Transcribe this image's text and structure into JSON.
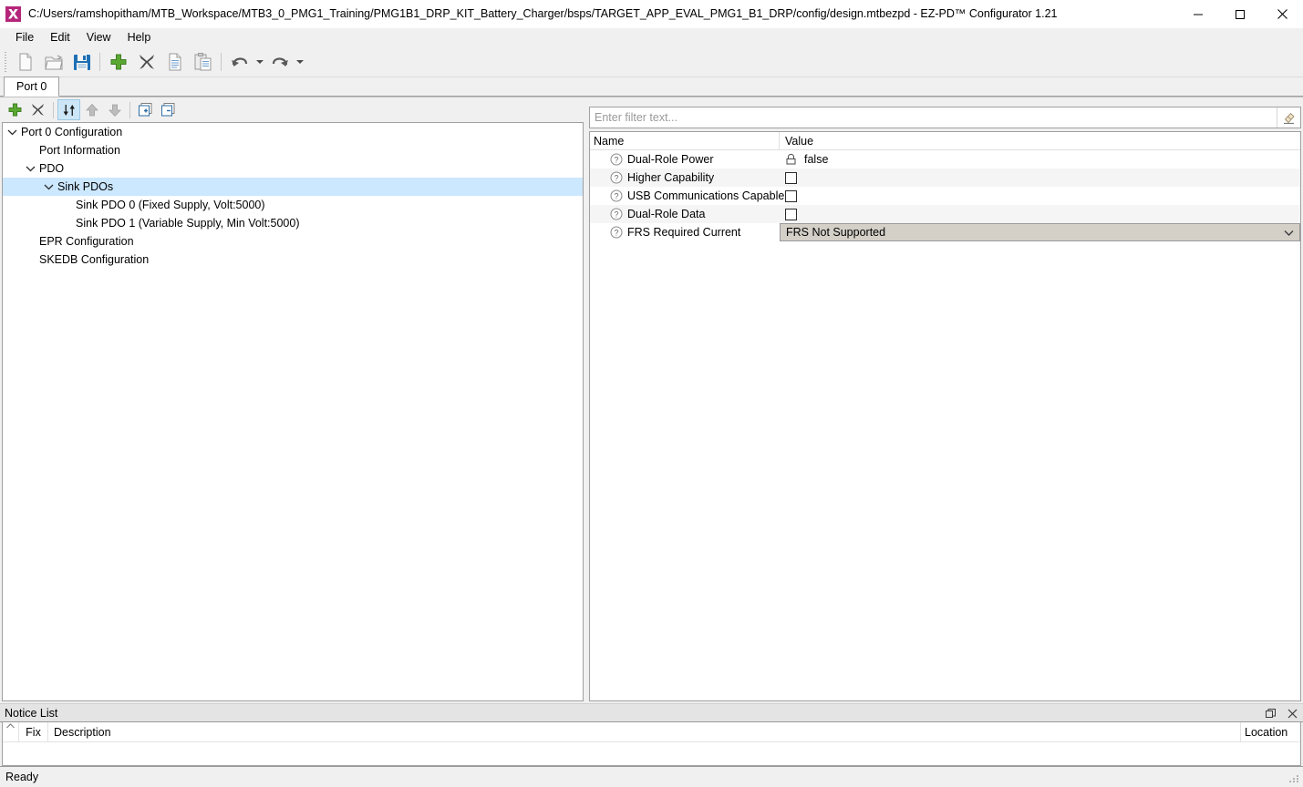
{
  "window": {
    "title": "C:/Users/ramshopitham/MTB_Workspace/MTB3_0_PMG1_Training/PMG1B1_DRP_KIT_Battery_Charger/bsps/TARGET_APP_EVAL_PMG1_B1_DRP/config/design.mtbezpd - EZ-PD™ Configurator 1.21",
    "app_icon": "ezpd-app-icon",
    "controls": {
      "minimize": "minimize-icon",
      "maximize": "maximize-icon",
      "close": "close-icon"
    }
  },
  "menubar": {
    "items": [
      {
        "label": "File"
      },
      {
        "label": "Edit"
      },
      {
        "label": "View"
      },
      {
        "label": "Help"
      }
    ]
  },
  "toolbar": {
    "buttons": [
      {
        "name": "new-file-button",
        "icon": "new-file-icon",
        "enabled": false
      },
      {
        "name": "open-file-button",
        "icon": "open-folder-icon",
        "enabled": false
      },
      {
        "name": "save-button",
        "icon": "save-floppy-icon",
        "enabled": true
      },
      {
        "name": "add-button",
        "icon": "plus-icon",
        "enabled": true
      },
      {
        "name": "delete-button",
        "icon": "x-delete-icon",
        "enabled": true
      },
      {
        "name": "copy-button",
        "icon": "copy-icon",
        "enabled": false
      },
      {
        "name": "paste-button",
        "icon": "paste-icon",
        "enabled": false
      },
      {
        "name": "undo-button",
        "icon": "undo-arrow-icon",
        "enabled": true
      },
      {
        "name": "redo-button",
        "icon": "redo-arrow-icon",
        "enabled": true
      }
    ]
  },
  "tabs": {
    "items": [
      {
        "label": "Port 0",
        "active": true
      }
    ]
  },
  "tree_toolbar": {
    "buttons": [
      {
        "name": "tree-add-button",
        "icon": "plus-icon",
        "state": "enabled"
      },
      {
        "name": "tree-delete-button",
        "icon": "x-delete-icon",
        "state": "enabled"
      },
      {
        "name": "tree-sort-button",
        "icon": "sort-updown-icon",
        "state": "active"
      },
      {
        "name": "tree-move-up-button",
        "icon": "arrow-up-icon",
        "state": "disabled"
      },
      {
        "name": "tree-move-down-button",
        "icon": "arrow-down-icon",
        "state": "disabled"
      },
      {
        "name": "tree-expand-all-button",
        "icon": "expand-plus-box-icon",
        "state": "enabled"
      },
      {
        "name": "tree-collapse-all-button",
        "icon": "collapse-minus-box-icon",
        "state": "enabled"
      }
    ]
  },
  "tree": {
    "nodes": [
      {
        "label": "Port 0 Configuration",
        "depth": 0,
        "twisty": "expanded",
        "selected": false
      },
      {
        "label": "Port Information",
        "depth": 1,
        "twisty": "none",
        "selected": false
      },
      {
        "label": "PDO",
        "depth": 1,
        "twisty": "expanded",
        "selected": false
      },
      {
        "label": "Sink PDOs",
        "depth": 2,
        "twisty": "expanded",
        "selected": true
      },
      {
        "label": "Sink PDO 0 (Fixed Supply, Volt:5000)",
        "depth": 3,
        "twisty": "none",
        "selected": false
      },
      {
        "label": "Sink PDO 1 (Variable Supply, Min Volt:5000)",
        "depth": 3,
        "twisty": "none",
        "selected": false
      },
      {
        "label": "EPR Configuration",
        "depth": 1,
        "twisty": "none",
        "selected": false
      },
      {
        "label": "SKEDB Configuration",
        "depth": 1,
        "twisty": "none",
        "selected": false
      }
    ]
  },
  "properties": {
    "filter": {
      "value": "",
      "placeholder": "Enter filter text...",
      "clear_icon": "eraser-icon"
    },
    "columns": {
      "name": "Name",
      "value": "Value"
    },
    "rows": [
      {
        "name": "Dual-Role Power",
        "help": "help-icon",
        "type": "readonly",
        "value": "false",
        "lock": "lock-icon"
      },
      {
        "name": "Higher Capability",
        "help": "help-icon",
        "type": "checkbox",
        "checked": false,
        "value": ""
      },
      {
        "name": "USB Communications Capable",
        "help": "help-icon",
        "type": "checkbox",
        "checked": false,
        "value": ""
      },
      {
        "name": "Dual-Role Data",
        "help": "help-icon",
        "type": "checkbox",
        "checked": false,
        "value": ""
      },
      {
        "name": "FRS Required Current",
        "help": "help-icon",
        "type": "combo",
        "value": "FRS Not Supported",
        "arrow": "chevron-down-icon"
      }
    ]
  },
  "notice_list": {
    "title": "Notice List",
    "restore_icon": "restore-panel-icon",
    "close_icon": "close-icon",
    "sort_indicator": "chevron-up-icon",
    "columns": {
      "fix": "Fix",
      "description": "Description",
      "location": "Location"
    },
    "rows": []
  },
  "statusbar": {
    "message": "Ready",
    "grip": "resize-grip-icon"
  },
  "colors": {
    "accent_selection": "#cce8ff",
    "brand_magenta": "#b4267a",
    "save_blue": "#1f6fb4",
    "plus_green": "#5aa832",
    "combo_grey": "#d4d0c8",
    "row_alt": "#f5f5f5",
    "chrome": "#f0f0f0"
  }
}
